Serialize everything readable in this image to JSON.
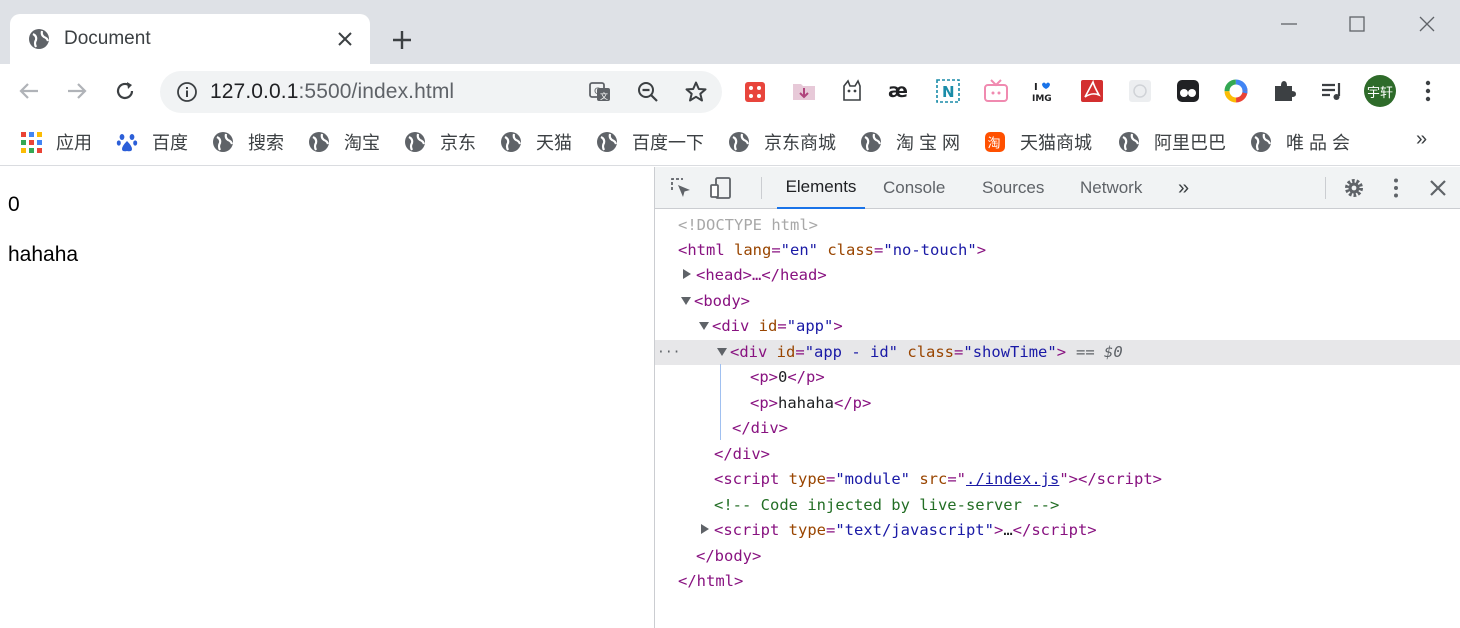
{
  "browser": {
    "tab": {
      "title": "Document"
    },
    "url": {
      "host": "127.0.0.1",
      "rest": ":5500/index.html"
    },
    "avatar_label": "宇轩"
  },
  "bookmarks": {
    "items": [
      {
        "label": "应用",
        "icon": "apps-grid-icon"
      },
      {
        "label": "百度",
        "icon": "baidu-paw-icon"
      },
      {
        "label": "搜索",
        "icon": "globe-icon"
      },
      {
        "label": "淘宝",
        "icon": "globe-icon"
      },
      {
        "label": "京东",
        "icon": "globe-icon"
      },
      {
        "label": "天猫",
        "icon": "globe-icon"
      },
      {
        "label": "百度一下",
        "icon": "globe-icon"
      },
      {
        "label": "京东商城",
        "icon": "globe-icon"
      },
      {
        "label": "淘 宝 网",
        "icon": "globe-icon"
      },
      {
        "label": "天猫商城",
        "icon": "taobao-icon"
      },
      {
        "label": "阿里巴巴",
        "icon": "globe-icon"
      },
      {
        "label": "唯 品 会",
        "icon": "globe-icon"
      }
    ],
    "more": "»"
  },
  "page": {
    "p1": "0",
    "p2": "hahaha"
  },
  "devtools": {
    "tabs": [
      "Elements",
      "Console",
      "Sources",
      "Network"
    ],
    "more_tabs": "»",
    "active_tab": "Elements",
    "dom": {
      "doctype": "<!DOCTYPE html>",
      "html_open_a": "<html ",
      "html_lang_attr": "lang",
      "html_lang_val": "\"en\"",
      "html_class_attr": "class",
      "html_class_val": "\"no-touch\"",
      "head": "<head>…</head>",
      "body_open": "<body>",
      "div_app_open": "<div ",
      "div_app_id_attr": "id",
      "div_app_id_val": "\"app\"",
      "div_inner_id_val": "\"app - id\"",
      "div_inner_class_val": "\"showTime\"",
      "selected_marker": "== $0",
      "p1_text": "0",
      "p2_text": "hahaha",
      "script_type_val": "\"module\"",
      "script_src_val": "./index.js",
      "comment": "<!-- Code injected by live-server -->",
      "script2_type_val": "\"text/javascript\"",
      "ellipsis": "…",
      "dots": "···"
    }
  },
  "colors": {
    "accent": "#1a73e8",
    "tag": "#881280",
    "attr": "#994500",
    "value": "#1a1aa6",
    "comment": "#236e25"
  }
}
